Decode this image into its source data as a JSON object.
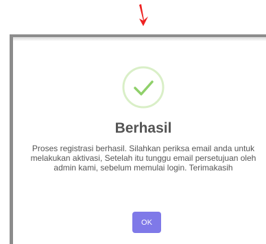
{
  "dialog": {
    "title": "Berhasil",
    "message": "Proses registrasi berhasil. Silahkan periksa email anda untuk melakukan aktivasi, Setelah itu tunggu email persetujuan oleh admin kami, sebelum memulai login. Terimakasih",
    "ok_label": "OK",
    "icon": "success-check-icon"
  },
  "annotation": {
    "icon": "red-arrow-down-icon"
  },
  "colors": {
    "accent_button": "#7f79e8",
    "success_ring": "#d9efc7",
    "success_check": "#8fd06a",
    "annotation_arrow": "#ee2222",
    "text": "#545454"
  }
}
